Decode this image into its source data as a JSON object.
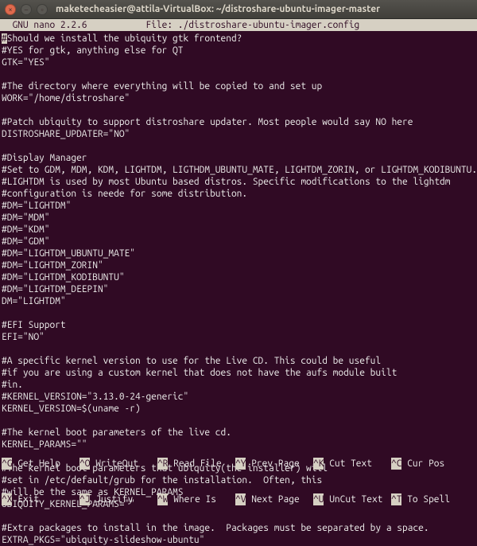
{
  "window": {
    "title": "maketecheasier@attila-VirtualBox: ~/distroshare-ubuntu-imager-master"
  },
  "nano_header": {
    "left": "  GNU nano 2.2.6",
    "center": "File: ./distroshare-ubuntu-imager.config"
  },
  "lines": [
    "#Should we install the ubiquity gtk frontend?",
    "#YES for gtk, anything else for QT",
    "GTK=\"YES\"",
    "",
    "#The directory where everything will be copied to and set up",
    "WORK=\"/home/distroshare\"",
    "",
    "#Patch ubiquity to support distroshare updater. Most people would say NO here",
    "DISTROSHARE_UPDATER=\"NO\"",
    "",
    "#Display Manager",
    "#Set to GDM, MDM, KDM, LIGHTDM, LIGTHDM_UBUNTU_MATE, LIGHTDM_ZORIN, or LIGHTDM_KODIBUNTU.",
    "#LIGHTDM is used by most Ubuntu based distros. Specific modifications to the lightdm",
    "#configuration is neede for some distribution.",
    "#DM=\"LIGHTDM\"",
    "#DM=\"MDM\"",
    "#DM=\"KDM\"",
    "#DM=\"GDM\"",
    "#DM=\"LIGHTDM_UBUNTU_MATE\"",
    "#DM=\"LIGHTDM_ZORIN\"",
    "#DM=\"LIGHTDM_KODIBUNTU\"",
    "#DM=\"LIGHTDM_DEEPIN\"",
    "DM=\"LIGHTDM\"",
    "",
    "#EFI Support",
    "EFI=\"NO\"",
    "",
    "#A specific kernel version to use for the Live CD. This could be useful",
    "#if you are using a custom kernel that does not have the aufs module built",
    "#in.",
    "#KERNEL_VERSION=\"3.13.0-24-generic\"",
    "KERNEL_VERSION=$(uname -r)",
    "",
    "#The kernel boot parameters of the live cd.",
    "KERNEL_PARAMS=\"\"",
    "",
    "#The kernel boot parameters that ubiquity(the installer) will",
    "#set in /etc/default/grub for the installation.  Often, this",
    "#will be the same as KERNEL_PARAMS",
    "UBIQUITY_KERNEL_PARAMS=\"\"",
    "",
    "#Extra packages to install in the image.  Packages must be separated by a space.",
    "EXTRA_PKGS=\"ubiquity-slideshow-ubuntu\""
  ],
  "footer": {
    "r1k1": "^G",
    "r1l1": "Get Help",
    "r1k2": "^O",
    "r1l2": "WriteOut",
    "r1k3": "^R",
    "r1l3": "Read File",
    "r1k4": "^Y",
    "r1l4": "Prev Page",
    "r1k5": "^K",
    "r1l5": "Cut Text",
    "r1k6": "^C",
    "r1l6": "Cur Pos",
    "r2k1": "^X",
    "r2l1": "Exit",
    "r2k2": "^J",
    "r2l2": "Justify",
    "r2k3": "^W",
    "r2l3": "Where Is",
    "r2k4": "^V",
    "r2l4": "Next Page",
    "r2k5": "^U",
    "r2l5": "UnCut Text",
    "r2k6": "^T",
    "r2l6": "To Spell"
  }
}
